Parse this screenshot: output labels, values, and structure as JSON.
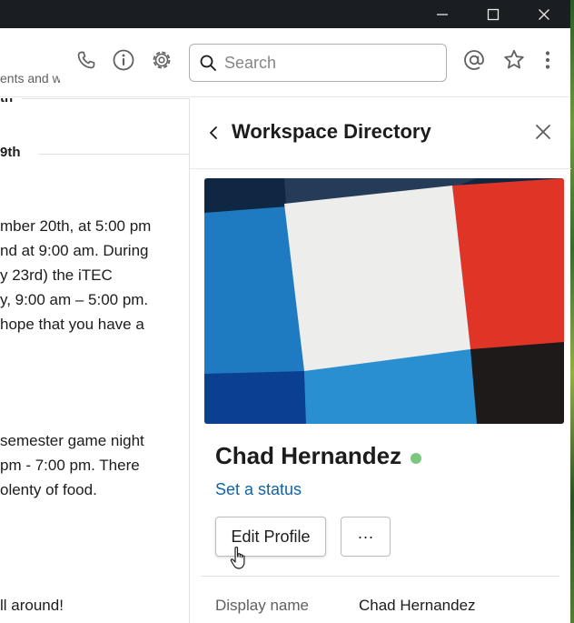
{
  "window": {
    "minimize_icon": "minimize-icon",
    "maximize_icon": "maximize-icon",
    "close_icon": "close-icon"
  },
  "header": {
    "topic": "ents and w",
    "search": {
      "placeholder": "Search",
      "value": ""
    },
    "icons": [
      "phone-icon",
      "info-icon",
      "gear-icon",
      "at-icon",
      "star-icon",
      "more-vertical-icon"
    ]
  },
  "messages": {
    "date_top": "th",
    "date_second": "9th",
    "block1": [
      "mber 20th, at 5:00 pm",
      "nd at 9:00 am. During",
      "y 23rd) the iTEC",
      "y, 9:00 am – 5:00 pm.",
      "hope that you have a"
    ],
    "block2": [
      "semester game night",
      "pm - 7:00 pm. There",
      "olenty of food."
    ],
    "block3": [
      "ll around!"
    ]
  },
  "panel": {
    "title": "Workspace Directory",
    "profile": {
      "name": "Chad Hernandez",
      "status_link": "Set a status",
      "presence_color": "#7bc77f",
      "edit_button": "Edit Profile",
      "more_button": "···"
    },
    "fields": [
      {
        "label": "Display name",
        "value": "Chad Hernandez"
      }
    ]
  },
  "colors": {
    "titlebar": "#1a1d21",
    "link": "#1264a3",
    "photo_red": "#e03426",
    "photo_blue": "#1f7bc1",
    "photo_navy": "#0f2742"
  }
}
